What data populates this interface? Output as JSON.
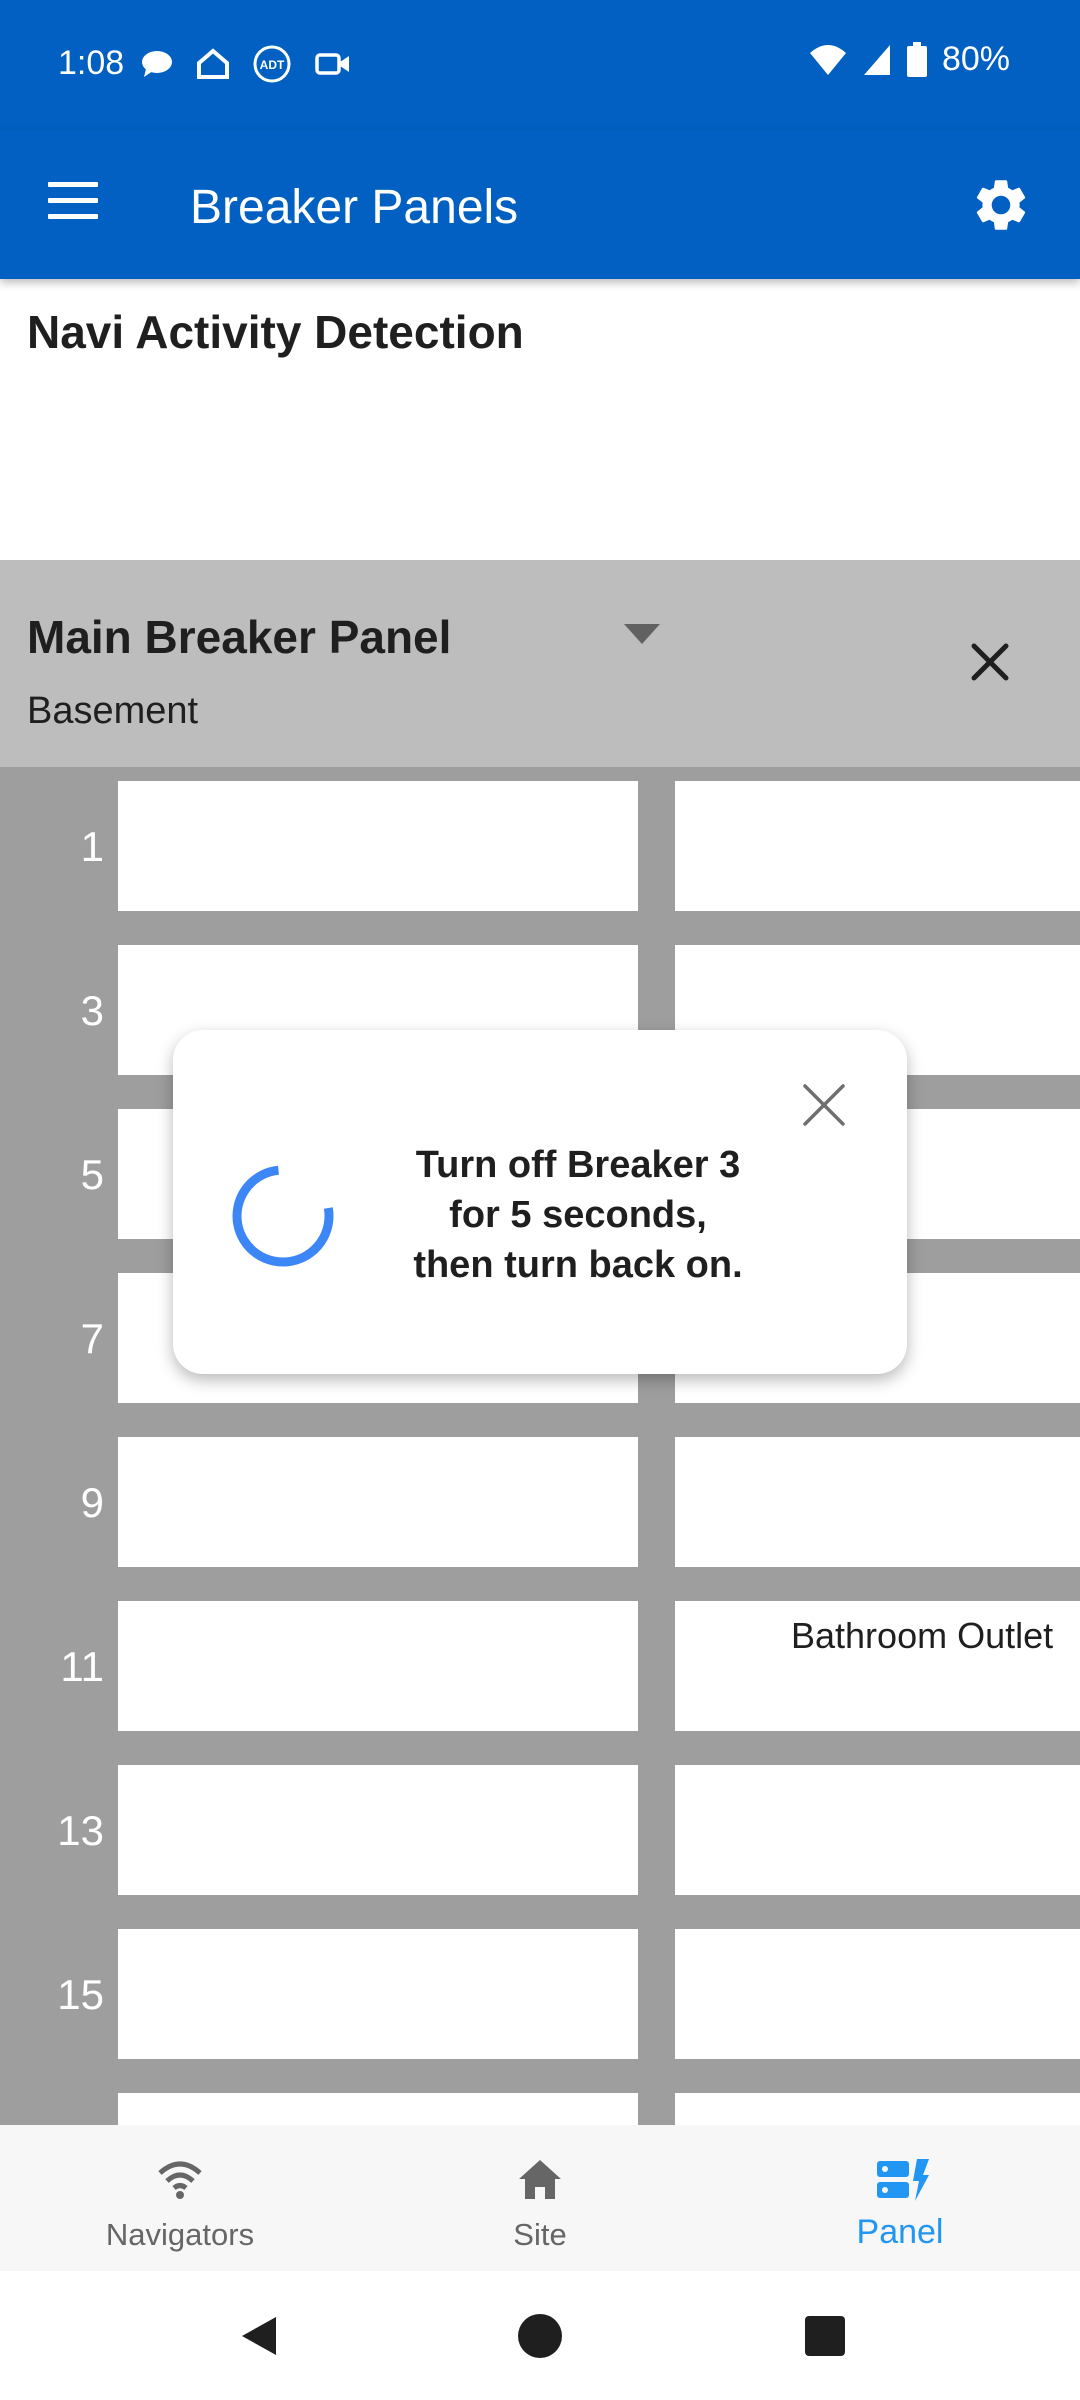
{
  "status_bar": {
    "time": "1:08",
    "battery": "80%",
    "icons": [
      "chat-bubble-icon",
      "home-outline-icon",
      "adt-icon",
      "video-camera-icon",
      "wifi-icon",
      "signal-icon",
      "battery-icon"
    ]
  },
  "app_bar": {
    "title": "Breaker Panels",
    "menu_icon": "menu-icon",
    "settings_icon": "gear-icon",
    "color": "#0160c1"
  },
  "section": {
    "title": "Navi Activity Detection"
  },
  "panel": {
    "name": "Main Breaker Panel",
    "location": "Basement"
  },
  "grid": {
    "rows": [
      {
        "number": "1",
        "left_label": "",
        "right_label": ""
      },
      {
        "number": "3",
        "left_label": "",
        "right_label": ""
      },
      {
        "number": "5",
        "left_label": "",
        "right_label": ""
      },
      {
        "number": "7",
        "left_label": "",
        "right_label": ""
      },
      {
        "number": "9",
        "left_label": "",
        "right_label": ""
      },
      {
        "number": "11",
        "left_label": "",
        "right_label": "Bathroom Outlet"
      },
      {
        "number": "13",
        "left_label": "",
        "right_label": ""
      },
      {
        "number": "15",
        "left_label": "",
        "right_label": ""
      },
      {
        "number": "",
        "left_label": "",
        "right_label": ""
      }
    ]
  },
  "popup": {
    "message_line1": "Turn off Breaker 3",
    "message_line2": "for 5 seconds,",
    "message_line3": "then turn back on.",
    "spinner_color": "#3d86f5"
  },
  "bottom_nav": {
    "items": [
      {
        "label": "Navigators",
        "icon": "wifi-icon",
        "active": false
      },
      {
        "label": "Site",
        "icon": "home-icon",
        "active": false
      },
      {
        "label": "Panel",
        "icon": "panel-icon",
        "active": true
      }
    ],
    "active_color": "#2196f3"
  },
  "system_nav": {
    "buttons": [
      "back-icon",
      "home-circle-icon",
      "recents-icon"
    ]
  }
}
